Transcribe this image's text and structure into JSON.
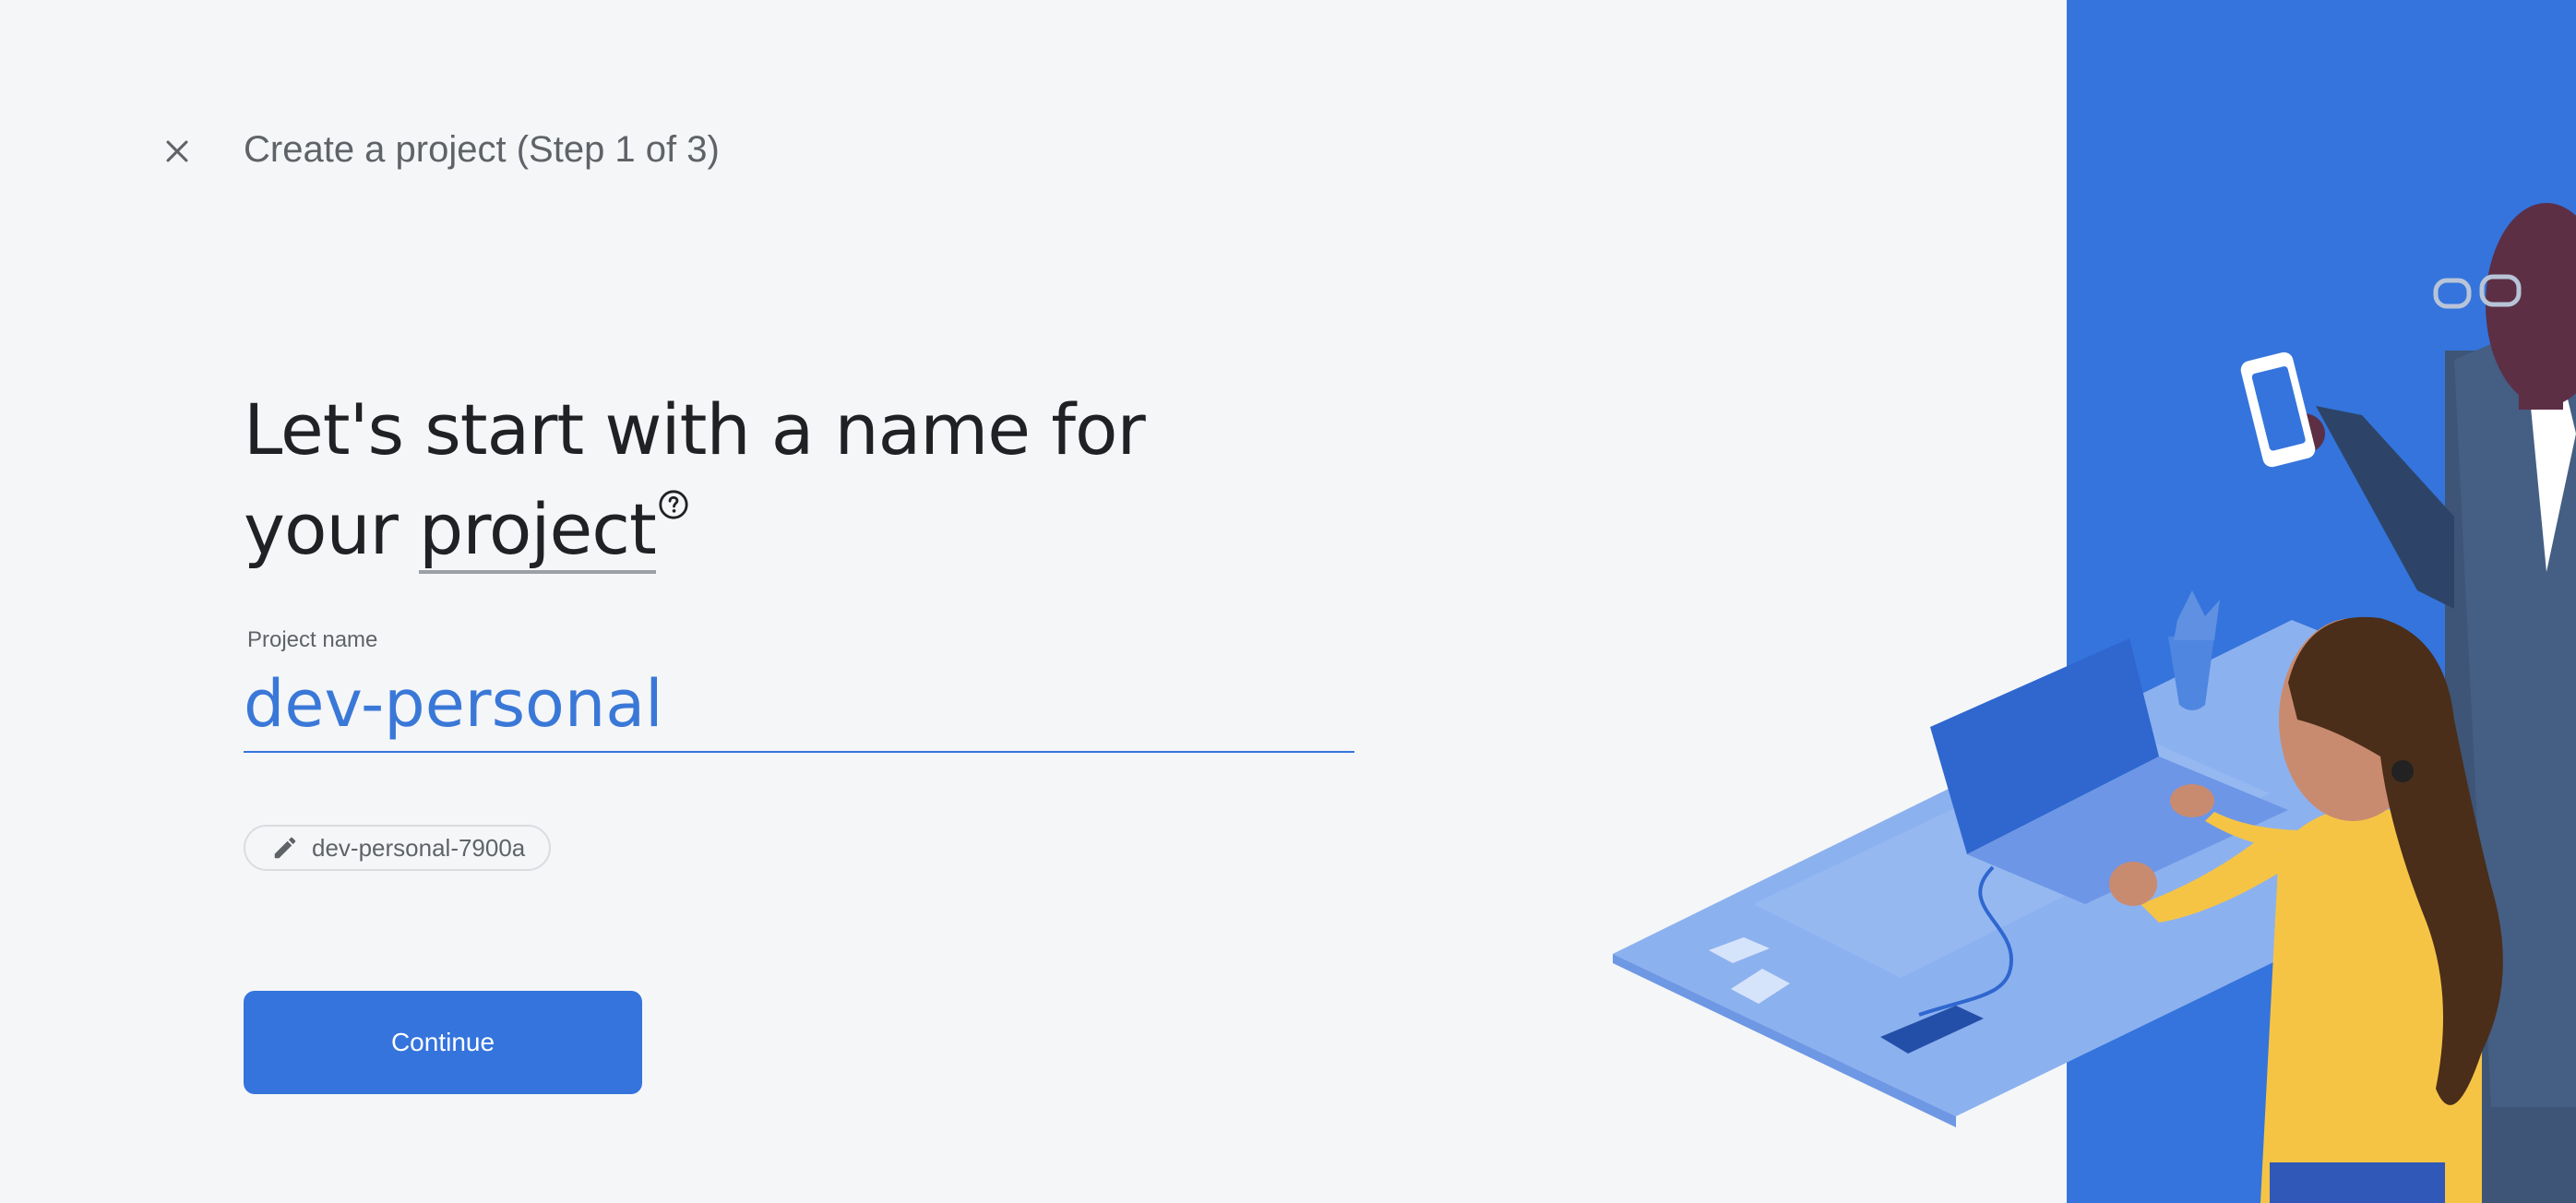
{
  "header": {
    "close_icon": "close-icon",
    "step_title": "Create a project (Step 1 of 3)"
  },
  "headline": {
    "line1": "Let's start with a name for",
    "line2_prefix": "your ",
    "line2_term": "project",
    "help_icon": "help-icon"
  },
  "project_name_field": {
    "label": "Project name",
    "value": "dev-personal"
  },
  "project_id_chip": {
    "icon": "pencil-icon",
    "value": "dev-personal-7900a"
  },
  "continue_button": {
    "label": "Continue"
  },
  "colors": {
    "accent": "#3474dc",
    "background": "#f5f6f8",
    "panel_blue": "#3474dc",
    "text_primary": "#202124",
    "text_secondary": "#5f6368"
  }
}
